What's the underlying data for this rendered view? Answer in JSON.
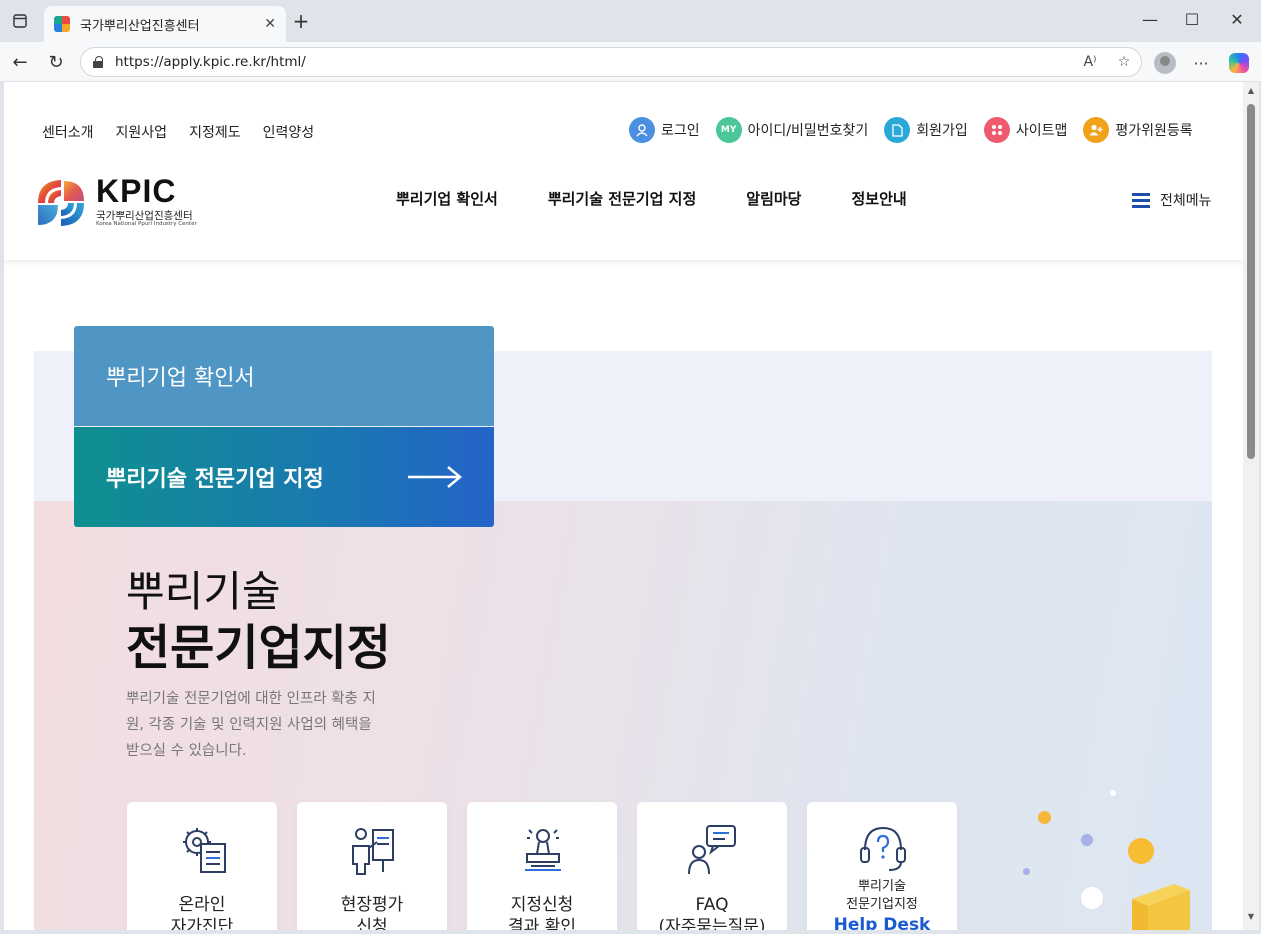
{
  "browser": {
    "tab_title": "국가뿌리산업진흥센터",
    "url": "https://apply.kpic.re.kr/html/",
    "icons": [
      "sidebar-icon",
      "close-icon",
      "plus-icon",
      "minimize-icon",
      "maximize-icon",
      "window-close-icon",
      "back-icon",
      "refresh-icon",
      "lock-icon",
      "read-aloud-icon",
      "star-icon",
      "profile-icon",
      "more-icon",
      "copilot-icon"
    ]
  },
  "header": {
    "util_left": [
      "센터소개",
      "지원사업",
      "지정제도",
      "인력양성"
    ],
    "util_right": [
      {
        "label": "로그인",
        "icon": "user-icon",
        "color": "#4a8fe0"
      },
      {
        "label": "아이디/비밀번호찾기",
        "icon": "my-icon",
        "badge": "MY",
        "color": "#4cc79a"
      },
      {
        "label": "회원가입",
        "icon": "document-icon",
        "color": "#2aa9d9"
      },
      {
        "label": "사이트맵",
        "icon": "grid-icon",
        "color": "#ef5a6f"
      },
      {
        "label": "평가위원등록",
        "icon": "user-add-icon",
        "color": "#f0a21b"
      }
    ],
    "logo": {
      "word": "KPIC",
      "name": "국가뿌리산업진흥센터",
      "english": "Korea National Ppuri Industry Center"
    },
    "gnb": [
      "뿌리기업 확인서",
      "뿌리기술 전문기업 지정",
      "알림마당",
      "정보안내"
    ],
    "all_menu": "전체메뉴"
  },
  "main": {
    "tab_confirm": "뿌리기업 확인서",
    "tab_designation": "뿌리기술 전문기업 지정",
    "hero_line1": "뿌리기술",
    "hero_line2": "전문기업지정",
    "hero_desc": "뿌리기술 전문기업에 대한 인프라 확충 지원, 각종 기술 및 인력지원 사업의 혜택을 받으실 수 있습니다.",
    "cards": [
      {
        "line1": "온라인",
        "line2": "자가진단",
        "icon": "gear-checklist-icon"
      },
      {
        "line1": "현장평가",
        "line2": "신청",
        "icon": "presenter-icon"
      },
      {
        "line1": "지정신청",
        "line2": "결과 확인",
        "icon": "stamp-icon"
      },
      {
        "line1": "FAQ",
        "line2": "(자주묻는질문)",
        "icon": "chat-people-icon"
      },
      {
        "line1": "뿌리기술",
        "line2": "전문기업지정",
        "line3": "Help Desk",
        "icon": "headset-icon"
      }
    ]
  },
  "colors": {
    "tab_confirm": "#4f96c4",
    "tab_designation_start": "#0e8f8f",
    "tab_designation_end": "#2463c9",
    "gnb_accent": "#1b4fa8",
    "helpdesk": "#1a5bd1"
  }
}
